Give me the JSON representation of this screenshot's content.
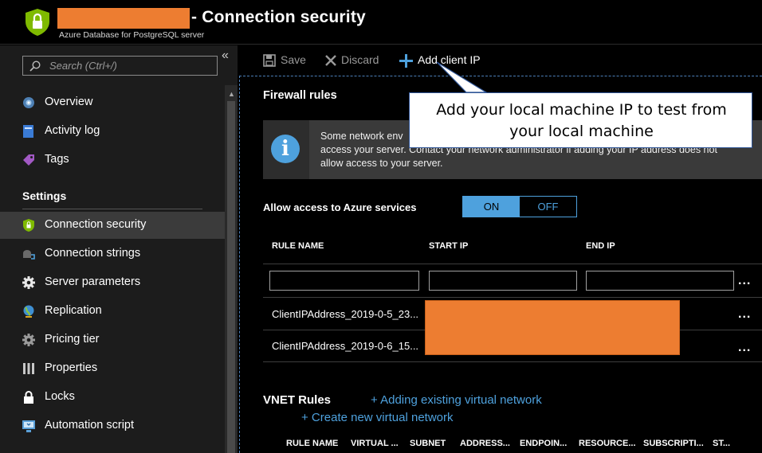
{
  "header": {
    "title": "- Connection security",
    "subtitle": "Azure Database for PostgreSQL server"
  },
  "sidebar": {
    "search_placeholder": "Search (Ctrl+/)",
    "collapse_glyph": "«",
    "items_top": [
      {
        "label": "Overview",
        "icon": "overview-icon"
      },
      {
        "label": "Activity log",
        "icon": "activity-log-icon"
      },
      {
        "label": "Tags",
        "icon": "tag-icon"
      }
    ],
    "settings_header": "Settings",
    "items_settings": [
      {
        "label": "Connection security",
        "icon": "shield-icon",
        "active": true
      },
      {
        "label": "Connection strings",
        "icon": "connection-strings-icon"
      },
      {
        "label": "Server parameters",
        "icon": "gear-icon"
      },
      {
        "label": "Replication",
        "icon": "globe-icon"
      },
      {
        "label": "Pricing tier",
        "icon": "pricing-gear-icon"
      },
      {
        "label": "Properties",
        "icon": "properties-icon"
      },
      {
        "label": "Locks",
        "icon": "lock-icon"
      },
      {
        "label": "Automation script",
        "icon": "automation-icon"
      }
    ]
  },
  "toolbar": {
    "save_label": "Save",
    "discard_label": "Discard",
    "add_client_ip_label": "Add client IP"
  },
  "firewall": {
    "title": "Firewall rules",
    "info_text": "Some network env... access your server. Contact your network administrator if adding your IP address does not allow access to your server.",
    "info_line1": "Some network env",
    "info_line2": "access your server. Contact your network administrator if adding your IP address does not",
    "info_line3": "allow access to your server.",
    "allow_azure_label": "Allow access to Azure services",
    "toggle_on": "ON",
    "toggle_off": "OFF",
    "columns": [
      "RULE NAME",
      "START IP",
      "END IP"
    ],
    "rows": [
      {
        "rule_name": "ClientIPAddress_2019-0-5_23..."
      },
      {
        "rule_name": "ClientIPAddress_2019-0-6_15..."
      }
    ],
    "ellipsis": "..."
  },
  "vnet": {
    "title": "VNET Rules",
    "add_existing": "+ Adding existing virtual network",
    "create_new": "+ Create new virtual network",
    "columns": [
      "RULE NAME",
      "VIRTUAL ...",
      "SUBNET",
      "ADDRESS...",
      "ENDPOIN...",
      "RESOURCE...",
      "SUBSCRIPTI...",
      "ST..."
    ]
  },
  "callout": {
    "line1": "Add your local machine IP to test from",
    "line2": "your local machine"
  },
  "colors": {
    "accent": "#4ea1dd",
    "redaction": "#ed7d31",
    "shield": "#7fba00"
  }
}
